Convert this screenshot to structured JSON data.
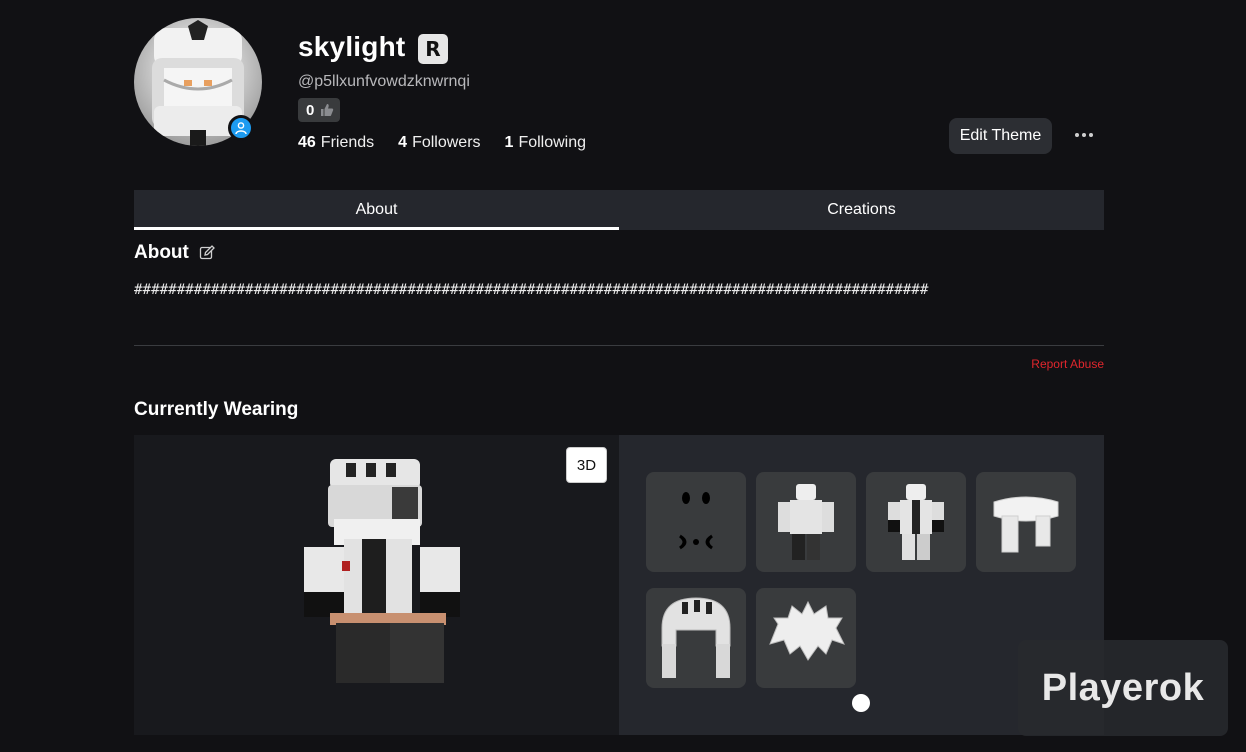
{
  "profile": {
    "display_name": "skylight",
    "badge_letter": "R",
    "username": "@p5llxunfvowdzknwrnqi",
    "reputation": "0",
    "friends_count": "46",
    "friends_label": "Friends",
    "followers_count": "4",
    "followers_label": "Followers",
    "following_count": "1",
    "following_label": "Following",
    "presence_color": "#1d9bf0"
  },
  "actions": {
    "edit_theme": "Edit Theme"
  },
  "tabs": [
    {
      "label": "About",
      "active": true
    },
    {
      "label": "Creations",
      "active": false
    }
  ],
  "about": {
    "title": "About",
    "text": "#############################################################################################",
    "report": "Report Abuse"
  },
  "wearing": {
    "title": "Currently Wearing",
    "toggle_3d": "3D",
    "items": [
      {
        "icon": "face-item-icon"
      },
      {
        "icon": "shirt-item-icon"
      },
      {
        "icon": "outfit-item-icon"
      },
      {
        "icon": "scarf-item-icon"
      },
      {
        "icon": "hat-item-icon"
      },
      {
        "icon": "hair-item-icon"
      }
    ]
  },
  "watermark": "Playerok"
}
